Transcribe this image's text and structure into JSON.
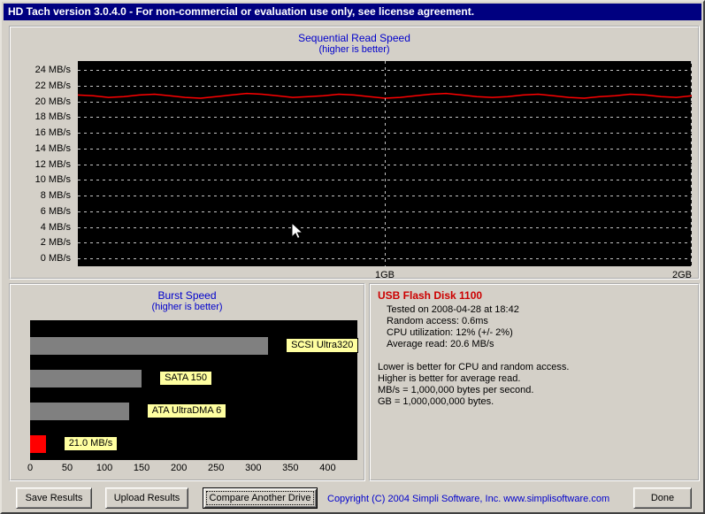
{
  "title_bar": {
    "text": "HD Tach version 3.0.4.0  - For non-commercial or evaluation use only, see license agreement."
  },
  "colors": {
    "titlebar_bg": "#000080",
    "window_bg": "#d4d0c8",
    "chart_title_blue": "#0000cc",
    "plot_bg": "#000000",
    "grid_color": "#c4c4c4",
    "read_line_red": "#ff0000",
    "bar_gray": "#808080",
    "bar_red": "#ff0000",
    "label_yellow": "#ffffa0",
    "drive_name_red": "#cc0000",
    "copyright_blue": "#0000cc"
  },
  "chart_data": [
    {
      "type": "line",
      "title": "Sequential Read Speed",
      "subtitle": "(higher is better)",
      "ylabel": "MB/s",
      "ylim": [
        0,
        24
      ],
      "y_tick_step": 2,
      "y_tick_labels": [
        "24 MB/s",
        "22 MB/s",
        "20 MB/s",
        "18 MB/s",
        "16 MB/s",
        "14 MB/s",
        "12 MB/s",
        "10 MB/s",
        "8 MB/s",
        "6 MB/s",
        "4 MB/s",
        "2 MB/s",
        "0 MB/s"
      ],
      "x_range_gb": [
        0,
        2
      ],
      "x_tick_labels": [
        {
          "label": "1GB",
          "pos": 0.5
        },
        {
          "label": "2GB",
          "pos": 1.0
        }
      ],
      "grid": true,
      "line_color": "#ff0000",
      "series": [
        {
          "name": "sequential read speed (MB/s)",
          "values": [
            20.8,
            20.7,
            20.5,
            20.6,
            20.8,
            20.9,
            20.7,
            20.5,
            20.4,
            20.6,
            20.8,
            21.0,
            20.9,
            20.7,
            20.5,
            20.6,
            20.7,
            20.9,
            20.8,
            20.6,
            20.4,
            20.5,
            20.7,
            20.9,
            21.0,
            20.8,
            20.6,
            20.5,
            20.6,
            20.8,
            20.9,
            20.7,
            20.5,
            20.4,
            20.6,
            20.7,
            20.9,
            20.8,
            20.6,
            20.5,
            20.7
          ]
        }
      ]
    },
    {
      "type": "bar",
      "orientation": "horizontal",
      "title": "Burst Speed",
      "subtitle": "(higher is better)",
      "xlim": [
        0,
        440
      ],
      "x_ticks": [
        0,
        50,
        100,
        150,
        200,
        250,
        300,
        350,
        400
      ],
      "label_bg": "#ffffa0",
      "bars": [
        {
          "label": "SCSI Ultra320",
          "value": 320,
          "color": "#808080"
        },
        {
          "label": "SATA 150",
          "value": 150,
          "color": "#808080"
        },
        {
          "label": "ATA UltraDMA 6",
          "value": 133,
          "color": "#808080"
        },
        {
          "label": "21.0 MB/s",
          "value": 21,
          "color": "#ff0000"
        }
      ]
    }
  ],
  "results": {
    "drive_name": "USB Flash Disk 1100",
    "details": [
      "Tested on 2008-04-28 at 18:42",
      "Random access: 0.6ms",
      "CPU utilization: 12% (+/- 2%)",
      "Average read: 20.6 MB/s"
    ],
    "notes": [
      "Lower is better for CPU and random access.",
      "Higher is better for average read.",
      "MB/s = 1,000,000 bytes per second.",
      "GB = 1,000,000,000 bytes."
    ]
  },
  "footer": {
    "save_label": "Save Results",
    "upload_label": "Upload Results",
    "compare_label": "Compare Another Drive",
    "done_label": "Done",
    "copyright": "Copyright (C) 2004 Simpli Software, Inc. www.simplisoftware.com"
  }
}
